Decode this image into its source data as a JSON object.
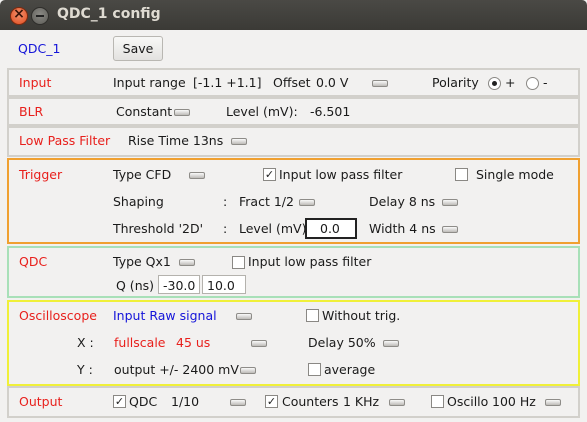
{
  "window": {
    "title": "QDC_1 config"
  },
  "header": {
    "name": "QDC_1",
    "save_label": "Save"
  },
  "input": {
    "label": "Input",
    "range_label": "Input range",
    "range_value": "[-1.1 +1.1]",
    "offset_label": "Offset",
    "offset_value": "0.0 V",
    "polarity_label": "Polarity",
    "polarity_options": [
      "+",
      "-"
    ],
    "polarity_selected": "+"
  },
  "blr": {
    "label": "BLR",
    "mode": "Constant",
    "level_label": "Level (mV):",
    "level_value": "-6.501"
  },
  "lpf": {
    "label": "Low Pass Filter",
    "rise_time": "Rise Time 13ns"
  },
  "trigger": {
    "label": "Trigger",
    "type": "Type CFD",
    "input_lpf_label": "Input low pass filter",
    "input_lpf_checked": "✓",
    "single_mode_label": "Single mode",
    "single_mode_checked": "",
    "shaping_label": "Shaping",
    "shaping_sep": ":",
    "shaping_value": "Fract 1/2",
    "delay": "Delay 8 ns",
    "threshold_label": "Threshold '2D'",
    "threshold_sep": ":",
    "level_label": "Level (mV)",
    "level_value": "0.0",
    "width": "Width 4 ns"
  },
  "qdc": {
    "label": "QDC",
    "type": "Type Qx1",
    "input_lpf_label": "Input low pass filter",
    "input_lpf_checked": "",
    "q_label": "Q (ns)",
    "q_start": "-30.0",
    "q_end": "10.0"
  },
  "oscilloscope": {
    "label": "Oscilloscope",
    "signal": "Input Raw signal",
    "without_trig_label": "Without trig.",
    "without_trig_checked": "",
    "x_label": "X :",
    "x_scale": "fullscale",
    "x_value": "45 us",
    "x_delay": "Delay 50%",
    "y_label": "Y :",
    "y_value": "output +/- 2400 mV",
    "average_label": "average",
    "average_checked": ""
  },
  "output": {
    "label": "Output",
    "qdc_label": "QDC",
    "qdc_checked": "✓",
    "qdc_value": "1/10",
    "counters_label": "Counters",
    "counters_checked": "✓",
    "counters_value": "1 KHz",
    "oscillo_label": "Oscillo",
    "oscillo_checked": "",
    "oscillo_value": "100 Hz"
  },
  "colors": {
    "trigger_border": "#f0a030",
    "qdc_border": "#a8e0b8",
    "oscilloscope_border": "#f0f038",
    "label_red": "#e8201c",
    "label_blue": "#1414d9"
  }
}
